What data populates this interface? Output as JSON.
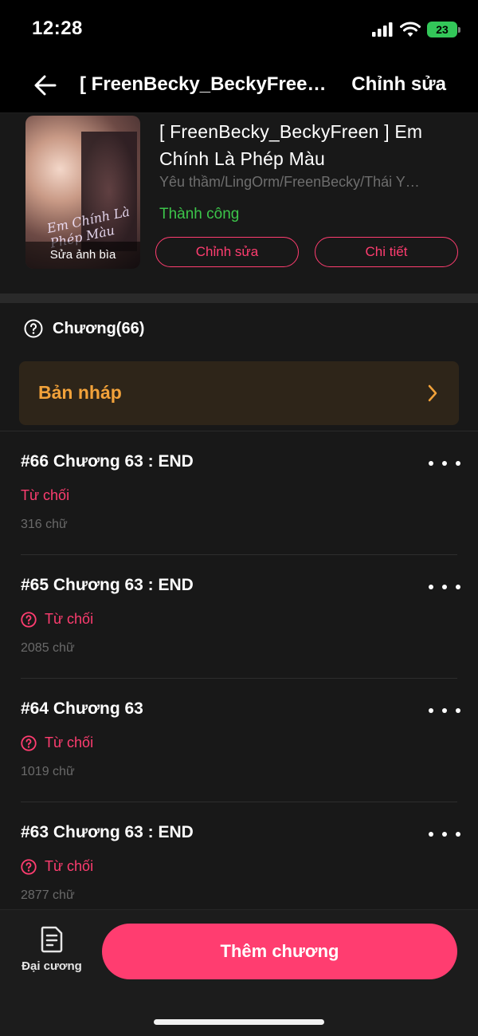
{
  "status_bar": {
    "time": "12:28",
    "battery": "23"
  },
  "nav": {
    "title": "[ FreenBecky_BeckyFreen ] Em Chính Là Phép Màu",
    "edit_label": "Chỉnh sửa"
  },
  "book": {
    "title": "[ FreenBecky_BeckyFreen ] Em Chính Là Phép Màu",
    "tags": "Yêu thầm/LingOrm/FreenBecky/Thái Y…",
    "status": "Thành công",
    "cover_text": "Em Chính Là Phép Màu",
    "cover_label": "Sửa ảnh bìa",
    "edit_button": "Chỉnh sửa",
    "detail_button": "Chi tiết"
  },
  "chapters_header": {
    "label": "Chương(66)"
  },
  "draft": {
    "label": "Bản nháp"
  },
  "chapters": [
    {
      "title": "#66 Chương 63 : END",
      "status": "Từ chối",
      "words": "316 chữ",
      "show_icon": false
    },
    {
      "title": "#65 Chương 63 : END",
      "status": "Từ chối",
      "words": "2085 chữ",
      "show_icon": true
    },
    {
      "title": "#64 Chương 63",
      "status": "Từ chối",
      "words": "1019 chữ",
      "show_icon": true
    },
    {
      "title": "#63 Chương 63 : END",
      "status": "Từ chối",
      "words": "2877 chữ",
      "show_icon": true
    }
  ],
  "bottom": {
    "outline_label": "Đại cương",
    "add_chapter_label": "Thêm chương"
  },
  "colors": {
    "accent": "#ff3d70",
    "success": "#3cc54a",
    "draft_text": "#f2a23a",
    "background": "#181818"
  }
}
